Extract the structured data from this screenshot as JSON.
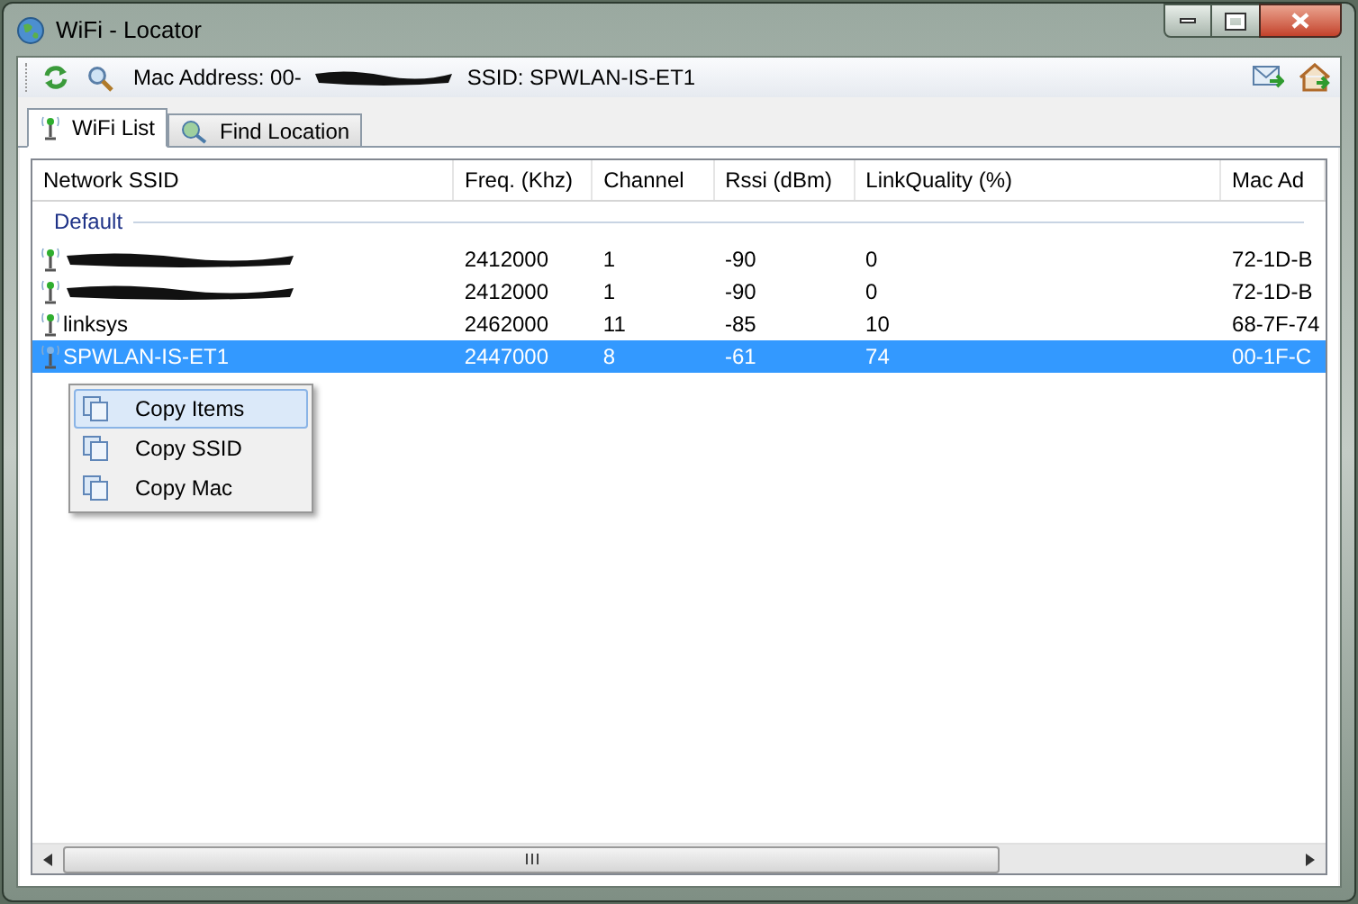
{
  "window": {
    "title": "WiFi - Locator"
  },
  "toolbar": {
    "mac_label": "Mac Address: 00-",
    "mac_redacted": true,
    "ssid_label": "SSID: SPWLAN-IS-ET1"
  },
  "tabs": [
    {
      "label": "WiFi List",
      "selected": true
    },
    {
      "label": "Find Location",
      "selected": false
    }
  ],
  "table": {
    "columns": [
      "Network SSID",
      "Freq. (Khz)",
      "Channel",
      "Rssi (dBm)",
      "LinkQuality (%)",
      "Mac Ad"
    ],
    "group": "Default",
    "rows": [
      {
        "ssid": "",
        "redacted": true,
        "freq": "2412000",
        "channel": "1",
        "rssi": "-90",
        "quality": "0",
        "mac": "72-1D-B",
        "selected": false
      },
      {
        "ssid": "",
        "redacted": true,
        "freq": "2412000",
        "channel": "1",
        "rssi": "-90",
        "quality": "0",
        "mac": "72-1D-B",
        "selected": false
      },
      {
        "ssid": "linksys",
        "redacted": false,
        "freq": "2462000",
        "channel": "11",
        "rssi": "-85",
        "quality": "10",
        "mac": "68-7F-74",
        "selected": false
      },
      {
        "ssid": "SPWLAN-IS-ET1",
        "redacted": false,
        "freq": "2447000",
        "channel": "8",
        "rssi": "-61",
        "quality": "74",
        "mac": "00-1F-C",
        "selected": true
      }
    ]
  },
  "context_menu": [
    {
      "label": "Copy Items",
      "selected": true
    },
    {
      "label": "Copy SSID",
      "selected": false
    },
    {
      "label": "Copy Mac",
      "selected": false
    }
  ]
}
